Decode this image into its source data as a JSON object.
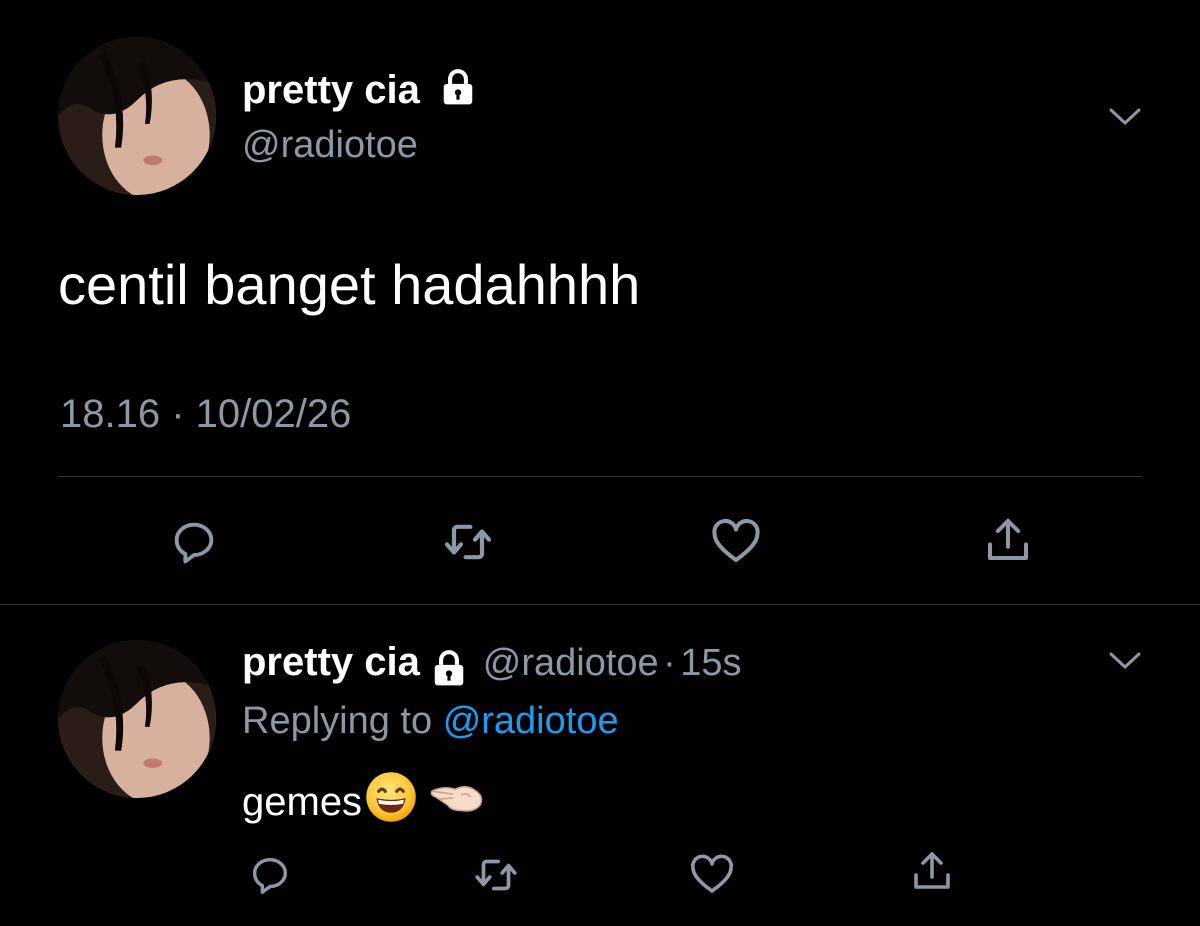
{
  "main_tweet": {
    "author_name": "pretty cia",
    "author_handle": "@radiotoe",
    "text": "centil banget hadahhhh",
    "timestamp": "18.16 · 10/02/26",
    "icons": {
      "lock": "lock-icon",
      "menu": "chevron-down-icon",
      "reply": "reply-icon",
      "retweet": "retweet-icon",
      "like": "heart-icon",
      "share": "share-icon"
    }
  },
  "reply_tweet": {
    "author_name": "pretty cia",
    "author_handle": "@radiotoe",
    "separator": "·",
    "time_ago": "15s",
    "replying_prefix": "Replying to",
    "replying_to": "@radiotoe",
    "text": "gemes",
    "emojis": [
      "grinning-face-emoji",
      "pinching-hand-emoji"
    ]
  },
  "colors": {
    "background": "#000000",
    "text_primary": "#ffffff",
    "text_secondary": "#8b98a5",
    "link": "#1d9bf0",
    "divider": "#2f3336",
    "icon": "#8b98a5"
  }
}
